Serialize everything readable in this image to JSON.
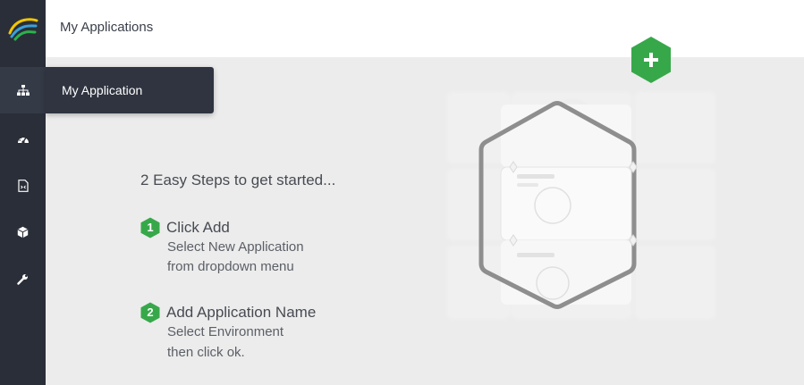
{
  "header": {
    "title": "My Applications"
  },
  "sidebar": {
    "items": [
      {
        "icon": "sitemap-icon",
        "label": "My Application",
        "active": true
      },
      {
        "icon": "dashboard-icon",
        "label": ""
      },
      {
        "icon": "document-icon",
        "label": ""
      },
      {
        "icon": "package-icon",
        "label": ""
      },
      {
        "icon": "wrench-icon",
        "label": ""
      }
    ]
  },
  "tooltip": {
    "label": "My Application"
  },
  "main": {
    "heading": "2 Easy Steps to get started...",
    "steps": [
      {
        "number": "1",
        "title": "Click Add",
        "lines": [
          "Select New Application",
          "from dropdown menu"
        ]
      },
      {
        "number": "2",
        "title": "Add Application Name",
        "lines": [
          "Select Environment",
          "then click ok."
        ]
      }
    ]
  },
  "colors": {
    "accent": "#37a84a",
    "sidebar": "#2a2e38",
    "background": "#ececec"
  },
  "add_button": {
    "icon": "plus-icon"
  }
}
